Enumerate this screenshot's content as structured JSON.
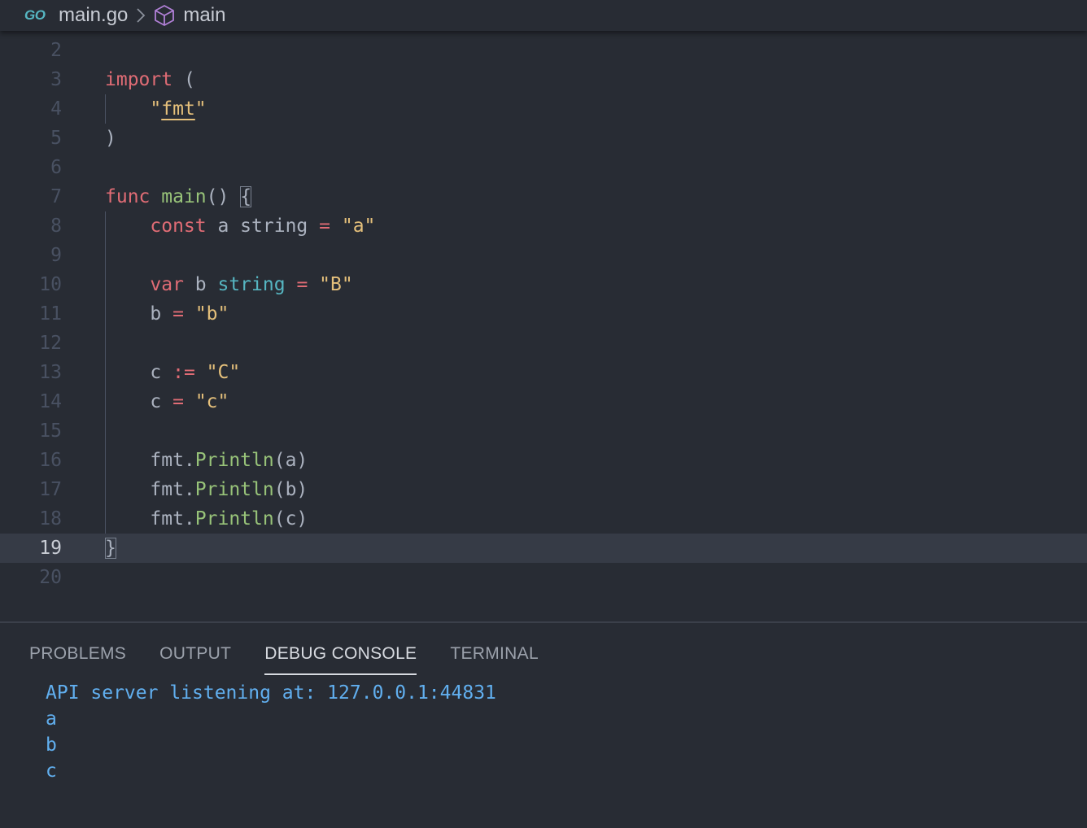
{
  "breadcrumb": {
    "language_badge": "GO",
    "file": "main.go",
    "symbol": "main"
  },
  "editor": {
    "current_line": 19,
    "lines": [
      {
        "n": "2",
        "tokens": []
      },
      {
        "n": "3",
        "tokens": [
          {
            "t": "import",
            "c": "kw"
          },
          {
            "t": " (",
            "c": "plain"
          }
        ]
      },
      {
        "n": "4",
        "tokens": [
          {
            "t": "    ",
            "c": "plain"
          },
          {
            "t": "\"",
            "c": "str"
          },
          {
            "t": "fmt",
            "c": "str u"
          },
          {
            "t": "\"",
            "c": "str"
          }
        ]
      },
      {
        "n": "5",
        "tokens": [
          {
            "t": ")",
            "c": "plain"
          }
        ]
      },
      {
        "n": "6",
        "tokens": []
      },
      {
        "n": "7",
        "tokens": [
          {
            "t": "func",
            "c": "kw"
          },
          {
            "t": " ",
            "c": "plain"
          },
          {
            "t": "main",
            "c": "fn"
          },
          {
            "t": "() ",
            "c": "plain"
          },
          {
            "t": "{",
            "c": "plain bm"
          }
        ]
      },
      {
        "n": "8",
        "tokens": [
          {
            "t": "    ",
            "c": "plain"
          },
          {
            "t": "const",
            "c": "kw"
          },
          {
            "t": " a string ",
            "c": "plain"
          },
          {
            "t": "=",
            "c": "op"
          },
          {
            "t": " ",
            "c": "plain"
          },
          {
            "t": "\"a\"",
            "c": "str"
          }
        ]
      },
      {
        "n": "9",
        "tokens": []
      },
      {
        "n": "10",
        "tokens": [
          {
            "t": "    ",
            "c": "plain"
          },
          {
            "t": "var",
            "c": "kw"
          },
          {
            "t": " b ",
            "c": "plain"
          },
          {
            "t": "string",
            "c": "type"
          },
          {
            "t": " ",
            "c": "plain"
          },
          {
            "t": "=",
            "c": "op"
          },
          {
            "t": " ",
            "c": "plain"
          },
          {
            "t": "\"B\"",
            "c": "str"
          }
        ]
      },
      {
        "n": "11",
        "tokens": [
          {
            "t": "    b ",
            "c": "plain"
          },
          {
            "t": "=",
            "c": "op"
          },
          {
            "t": " ",
            "c": "plain"
          },
          {
            "t": "\"b\"",
            "c": "str"
          }
        ]
      },
      {
        "n": "12",
        "tokens": []
      },
      {
        "n": "13",
        "tokens": [
          {
            "t": "    c ",
            "c": "plain"
          },
          {
            "t": ":=",
            "c": "op"
          },
          {
            "t": " ",
            "c": "plain"
          },
          {
            "t": "\"C\"",
            "c": "str"
          }
        ]
      },
      {
        "n": "14",
        "tokens": [
          {
            "t": "    c ",
            "c": "plain"
          },
          {
            "t": "=",
            "c": "op"
          },
          {
            "t": " ",
            "c": "plain"
          },
          {
            "t": "\"c\"",
            "c": "str"
          }
        ]
      },
      {
        "n": "15",
        "tokens": []
      },
      {
        "n": "16",
        "tokens": [
          {
            "t": "    fmt.",
            "c": "plain"
          },
          {
            "t": "Println",
            "c": "fn"
          },
          {
            "t": "(a)",
            "c": "plain"
          }
        ]
      },
      {
        "n": "17",
        "tokens": [
          {
            "t": "    fmt.",
            "c": "plain"
          },
          {
            "t": "Println",
            "c": "fn"
          },
          {
            "t": "(b)",
            "c": "plain"
          }
        ]
      },
      {
        "n": "18",
        "tokens": [
          {
            "t": "    fmt.",
            "c": "plain"
          },
          {
            "t": "Println",
            "c": "fn"
          },
          {
            "t": "(c)",
            "c": "plain"
          }
        ]
      },
      {
        "n": "19",
        "tokens": [
          {
            "t": "}",
            "c": "plain bm"
          }
        ]
      },
      {
        "n": "20",
        "tokens": []
      }
    ]
  },
  "panel": {
    "tabs": [
      {
        "label": "PROBLEMS",
        "active": false
      },
      {
        "label": "OUTPUT",
        "active": false
      },
      {
        "label": "DEBUG CONSOLE",
        "active": true
      },
      {
        "label": "TERMINAL",
        "active": false
      }
    ],
    "console_lines": [
      "API server listening at: 127.0.0.1:44831",
      "a",
      "b",
      "c"
    ]
  },
  "colors": {
    "background": "#282c34",
    "keyword": "#e06c75",
    "string": "#e5c07b",
    "function": "#98c379",
    "type": "#56b6c2",
    "console_text": "#61afef"
  }
}
